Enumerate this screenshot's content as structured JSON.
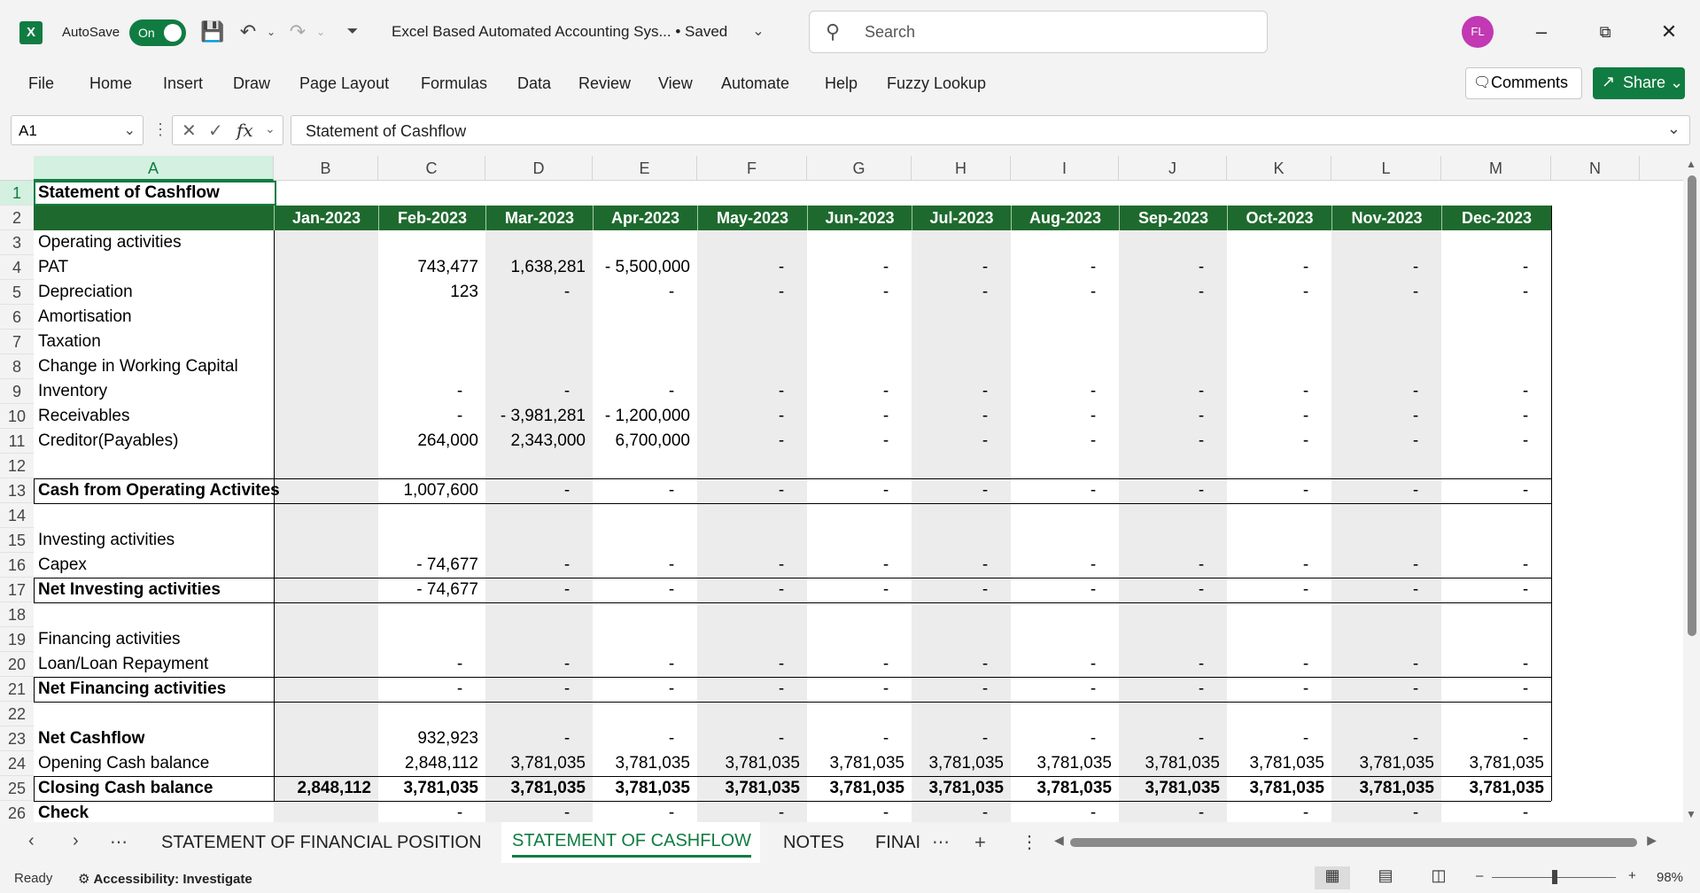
{
  "titlebar": {
    "autosave_label": "AutoSave",
    "autosave_state": "On",
    "doc_title": "Excel Based Automated Accounting Sys...  •  Saved",
    "search_placeholder": "Search",
    "avatar_initials": "FL"
  },
  "ribbon": {
    "tabs": [
      "File",
      "Home",
      "Insert",
      "Draw",
      "Page Layout",
      "Formulas",
      "Data",
      "Review",
      "View",
      "Automate",
      "Help",
      "Fuzzy Lookup"
    ],
    "comments_label": "Comments",
    "share_label": "Share"
  },
  "formula_bar": {
    "name_box": "A1",
    "formula": "Statement of Cashflow"
  },
  "columns": [
    "A",
    "B",
    "C",
    "D",
    "E",
    "F",
    "G",
    "H",
    "I",
    "J",
    "K",
    "L",
    "M",
    "N"
  ],
  "rows": [
    "1",
    "2",
    "3",
    "4",
    "5",
    "6",
    "7",
    "8",
    "9",
    "10",
    "11",
    "12",
    "13",
    "14",
    "15",
    "16",
    "17",
    "18",
    "19",
    "20",
    "21",
    "22",
    "23",
    "24",
    "25",
    "26"
  ],
  "sheet": {
    "title": "Statement of Cashflow",
    "months": [
      "Jan-2023",
      "Feb-2023",
      "Mar-2023",
      "Apr-2023",
      "May-2023",
      "Jun-2023",
      "Jul-2023",
      "Aug-2023",
      "Sep-2023",
      "Oct-2023",
      "Nov-2023",
      "Dec-2023"
    ],
    "labels": {
      "r3": "Operating activities",
      "r4": "PAT",
      "r5": "Depreciation",
      "r6": "Amortisation",
      "r7": "Taxation",
      "r8": "Change in Working Capital",
      "r9": "Inventory",
      "r10": "Receivables",
      "r11": "Creditor(Payables)",
      "r13": "Cash from Operating Activites",
      "r15": "Investing activities",
      "r16": "Capex",
      "r17": "Net Investing activities",
      "r19": "Financing activities",
      "r20": "Loan/Loan Repayment",
      "r21": "Net Financing activities",
      "r23": "Net Cashflow",
      "r24": "Opening Cash balance",
      "r25": "Closing Cash balance",
      "r26": "Check"
    },
    "values": {
      "r4": [
        "",
        "743,477",
        "1,638,281",
        "-  5,500,000",
        "-",
        "-",
        "-",
        "-",
        "-",
        "-",
        "-",
        "-"
      ],
      "r5": [
        "",
        "123",
        "-",
        "-",
        "-",
        "-",
        "-",
        "-",
        "-",
        "-",
        "-",
        "-"
      ],
      "r9": [
        "",
        "-",
        "-",
        "-",
        "-",
        "-",
        "-",
        "-",
        "-",
        "-",
        "-",
        "-"
      ],
      "r10": [
        "",
        "-",
        "-  3,981,281",
        "-  1,200,000",
        "-",
        "-",
        "-",
        "-",
        "-",
        "-",
        "-",
        "-"
      ],
      "r11": [
        "",
        "264,000",
        "2,343,000",
        "6,700,000",
        "-",
        "-",
        "-",
        "-",
        "-",
        "-",
        "-",
        "-"
      ],
      "r13": [
        "",
        "1,007,600",
        "-",
        "-",
        "-",
        "-",
        "-",
        "-",
        "-",
        "-",
        "-",
        "-"
      ],
      "r16": [
        "",
        "-      74,677",
        "-",
        "-",
        "-",
        "-",
        "-",
        "-",
        "-",
        "-",
        "-",
        "-"
      ],
      "r17": [
        "",
        "-      74,677",
        "-",
        "-",
        "-",
        "-",
        "-",
        "-",
        "-",
        "-",
        "-",
        "-"
      ],
      "r20": [
        "",
        "-",
        "-",
        "-",
        "-",
        "-",
        "-",
        "-",
        "-",
        "-",
        "-",
        "-"
      ],
      "r21": [
        "",
        "-",
        "-",
        "-",
        "-",
        "-",
        "-",
        "-",
        "-",
        "-",
        "-",
        "-"
      ],
      "r23": [
        "",
        "932,923",
        "-",
        "-",
        "-",
        "-",
        "-",
        "-",
        "-",
        "-",
        "-",
        "-"
      ],
      "r24": [
        "",
        "2,848,112",
        "3,781,035",
        "3,781,035",
        "3,781,035",
        "3,781,035",
        "3,781,035",
        "3,781,035",
        "3,781,035",
        "3,781,035",
        "3,781,035",
        "3,781,035"
      ],
      "r25": [
        "2,848,112",
        "3,781,035",
        "3,781,035",
        "3,781,035",
        "3,781,035",
        "3,781,035",
        "3,781,035",
        "3,781,035",
        "3,781,035",
        "3,781,035",
        "3,781,035",
        "3,781,035"
      ],
      "r26": [
        "",
        "-",
        "-",
        "-",
        "-",
        "-",
        "-",
        "-",
        "-",
        "-",
        "-",
        "-"
      ]
    }
  },
  "sheet_tabs": {
    "tabs": [
      "STATEMENT OF FINANCIAL POSITION",
      "STATEMENT OF CASHFLOW",
      "NOTES",
      "FINAI"
    ],
    "active": "STATEMENT OF CASHFLOW"
  },
  "status_bar": {
    "mode": "Ready",
    "accessibility": "Accessibility: Investigate",
    "zoom": "98%"
  },
  "colors": {
    "accent": "#107c41",
    "header_band": "#1e6a2e",
    "shade": "#ececec",
    "avatar": "#c239b3"
  }
}
